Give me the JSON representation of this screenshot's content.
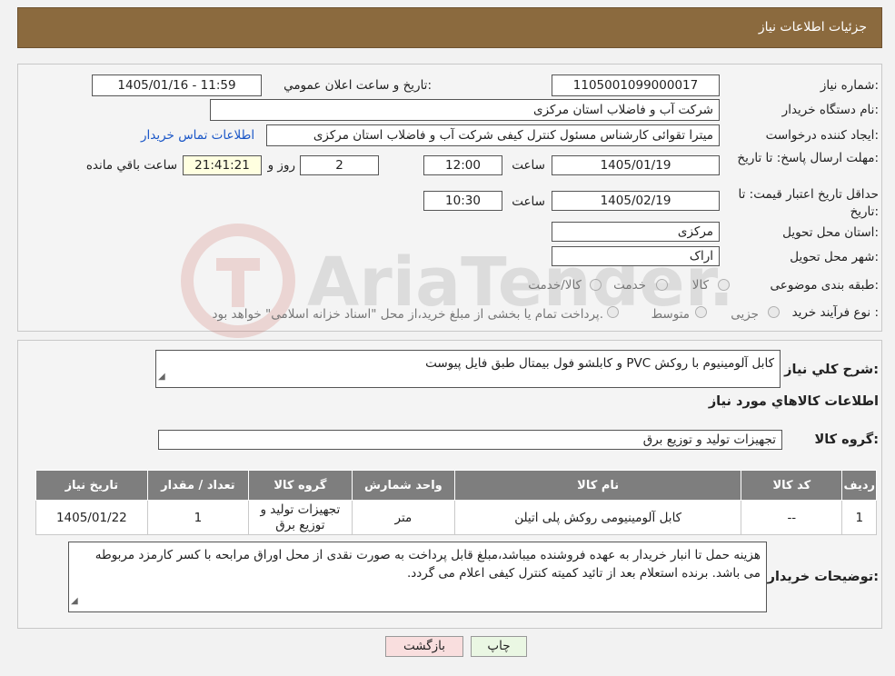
{
  "header": {
    "title": "جزئیات اطلاعات نیاز"
  },
  "form": {
    "need_number_label": "شماره نیاز:",
    "need_number": "1105001099000017",
    "announce_label": "تاریخ و ساعت اعلان عمومي:",
    "announce_value": "1405/01/16 - 11:59",
    "buyer_org_label": "نام دستگاه خريدار:",
    "buyer_org": "شرکت آب و فاضلاب استان مرکزی",
    "creator_label": "ایجاد کننده درخواست:",
    "creator": "میترا تقوائی کارشناس مسئول کنترل کیفی شرکت آب و فاضلاب استان مرکزی",
    "contact_link": "اطلاعات تماس خریدار",
    "deadline_label": "مهلت ارسال پاسخ: تا تاریخ:",
    "deadline_date": "1405/01/19",
    "time_label": "ساعت",
    "deadline_time": "12:00",
    "days": "2",
    "days_label": "روز و",
    "remaining": "21:41:21",
    "remaining_label": "ساعت باقي مانده",
    "validity_label": "حداقل تاریخ اعتبار قیمت: تا تاریخ:",
    "validity_date": "1405/02/19",
    "validity_time": "10:30",
    "province_label": "استان محل تحویل:",
    "province": "مرکزی",
    "city_label": "شهر محل تحویل:",
    "city": "اراک",
    "category_label": "طبقه بندی موضوعی:",
    "category_options": [
      "کالا",
      "خدمت",
      "کالا/خدمت"
    ],
    "process_label": "نوع فرآیند خرید :",
    "process_options": [
      "جزیی",
      "متوسط"
    ],
    "process_note": "پرداخت تمام یا بخشی از مبلغ خرید،از محل \"اسناد خزانه اسلامی\" خواهد بود."
  },
  "description": {
    "label": "شرح کلي نياز:",
    "value": "کابل آلومینیوم با روکش PVC و کابلشو فول بیمتال طبق فایل پیوست"
  },
  "goods": {
    "section_title": "اطلاعات کالاهاي مورد نياز",
    "group_label": "گروه کالا:",
    "group_value": "تجهیزات تولید و توزیع برق",
    "columns": [
      "ردیف",
      "کد کالا",
      "نام کالا",
      "واحد شمارش",
      "گروه کالا",
      "تعداد / مقدار",
      "تاریخ نیاز"
    ],
    "rows": [
      [
        "1",
        "--",
        "کابل آلومینیومی روکش پلی اتیلن",
        "متر",
        "تجهیزات تولید و توزیع برق",
        "1",
        "1405/01/22"
      ]
    ]
  },
  "notes": {
    "label": "توضیحات خریدار:",
    "value": "هزینه حمل تا انبار خریدار به عهده فروشنده میباشد،مبلغ قابل پرداخت به صورت نقدی از محل اوراق مرابحه با کسر کارمزد مربوطه می باشد. برنده استعلام بعد از تائید کمیته کنترل کیفی اعلام می گردد."
  },
  "buttons": {
    "print": "چاپ",
    "back": "بازگشت"
  },
  "watermark": {
    "text": "AriaTender.neT"
  },
  "colors": {
    "header": "#8b6a3e",
    "link": "#1a56c7",
    "print_btn": "#eaf7e3",
    "back_btn": "#f9dede"
  }
}
